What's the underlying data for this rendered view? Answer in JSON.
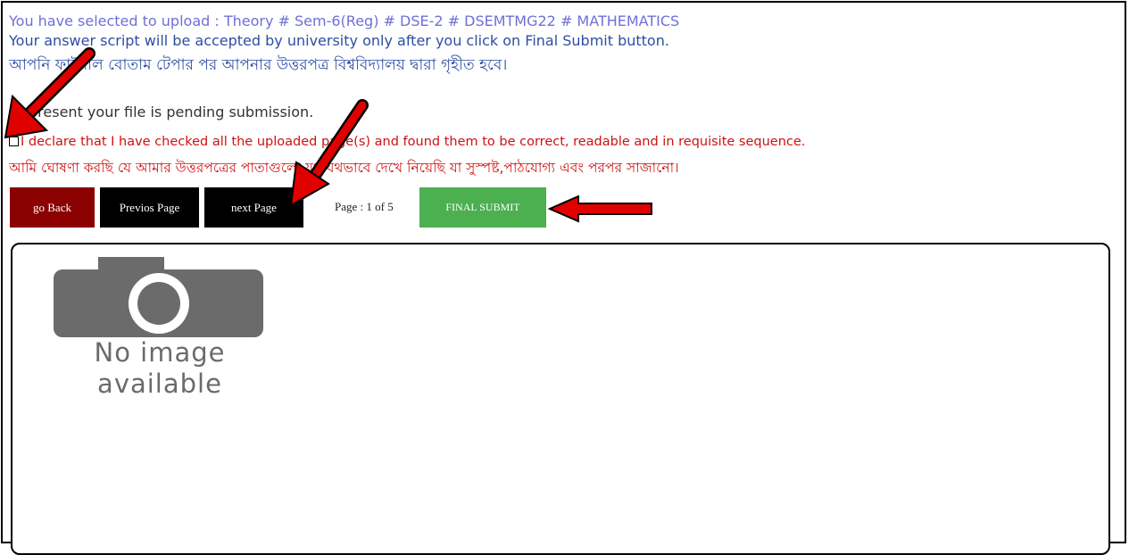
{
  "header": {
    "upload_line": "You have selected to upload : Theory # Sem-6(Reg) # DSE-2 # DSEMTMG22 # MATHEMATICS",
    "accept_line": "Your answer script will be accepted by university only after you click on Final Submit button.",
    "accept_line_bn": "আপনি ফাইনাল বোতাম টেপার পর আপনার উত্তরপত্র বিশ্ববিদ্যালয় দ্বারা গৃহীত হবে।",
    "status_line": "At present your file is pending submission."
  },
  "declaration": {
    "text_en": "I declare that I have checked all the uploaded page(s) and found them to be correct, readable and in requisite sequence.",
    "text_bn": "আমি ঘোষণা করছি যে আমার উত্তরপত্রের পাতাগুলো যথাযথভাবে দেখে নিয়েছি যা সুস্পষ্ট,পাঠযোগ্য এবং পরপর সাজানো।",
    "checked": false
  },
  "toolbar": {
    "go_back": "go Back",
    "prev_page": "Previos Page",
    "next_page": "next Page",
    "page_info": "Page : 1 of 5",
    "final_submit": "FINAL SUBMIT"
  },
  "viewer": {
    "placeholder_line1": "No image",
    "placeholder_line2": "available"
  },
  "colors": {
    "go_back_bg": "#8b0000",
    "nav_bg": "#000000",
    "final_submit_bg": "#4caf50",
    "declaration_text": "#d01010",
    "arrow": "#e00000"
  },
  "icons": [
    "camera-icon",
    "red-arrow-annotation"
  ]
}
